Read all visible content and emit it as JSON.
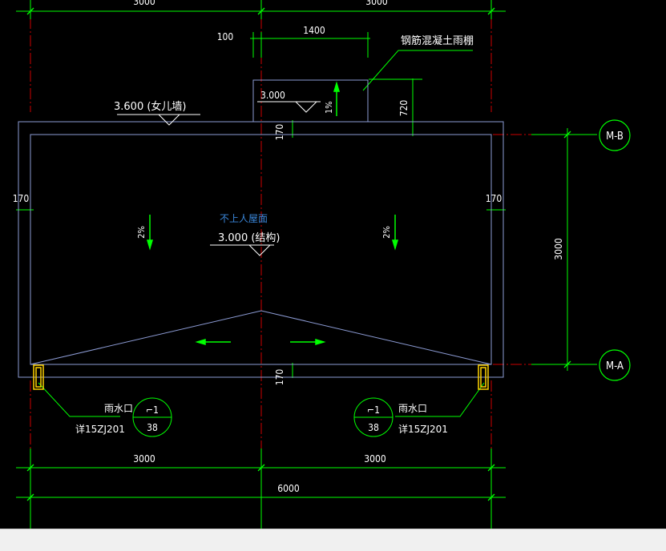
{
  "dims": {
    "top_left": "3000",
    "top_right": "3000",
    "canopy_offset": "100",
    "canopy_width": "1400",
    "canopy_depth": "720",
    "wall_top": "170",
    "wall_left": "170",
    "wall_right": "170",
    "wall_bottom": "170",
    "span": "3000",
    "bottom_left": "3000",
    "bottom_right": "3000",
    "total": "6000"
  },
  "labels": {
    "canopy": "钢筋混凝土雨棚",
    "parapet": "3.600 (女儿墙)",
    "canopy_elev": "3.000",
    "canopy_slope": "1%",
    "roof_type": "不上人屋面",
    "roof_elev": "3.000 (结构)",
    "slope_left": "2%",
    "slope_right": "2%"
  },
  "axes": {
    "b": "M-B",
    "a": "M-A"
  },
  "drains": {
    "left": {
      "label": "雨水口",
      "detail": "详15ZJ201",
      "symbol": "⌐1",
      "number": "38"
    },
    "right": {
      "label": "雨水口",
      "detail": "详15ZJ201",
      "symbol": "⌐1",
      "number": "38"
    }
  },
  "colors": {
    "background": "#000000",
    "outline": "#8c9bd4",
    "dimension": "#00ff00",
    "axis": "#cc0000",
    "text": "#ffffff",
    "roof_label": "#3a86d9",
    "status_bar": "#f0f0f0"
  }
}
